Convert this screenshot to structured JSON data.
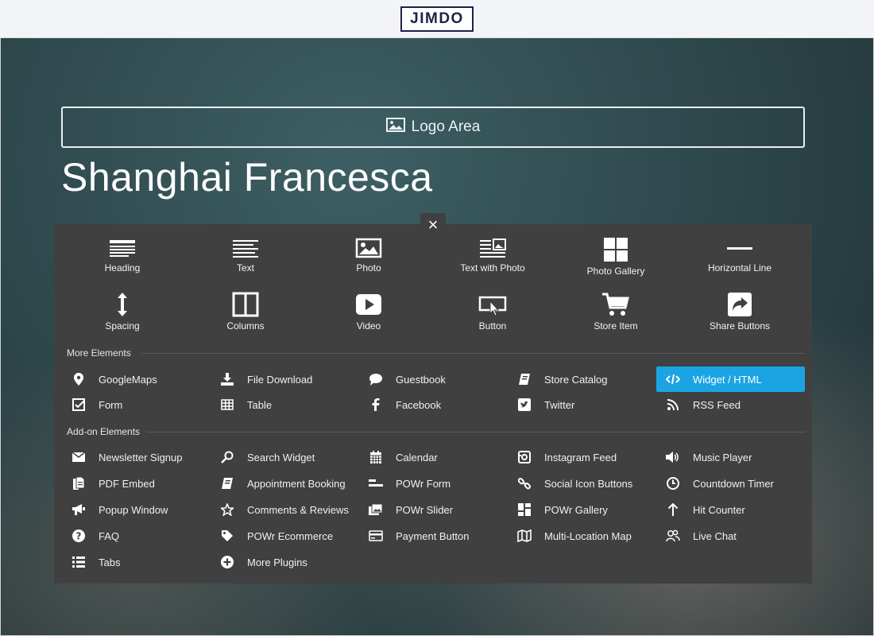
{
  "app": {
    "logo": "JIMDO"
  },
  "hero": {
    "logo_area_label": "Logo Area",
    "site_title": "Shanghai Francesca"
  },
  "panel": {
    "close_label": "×",
    "basic_elements": [
      {
        "label": "Heading",
        "icon": "heading-icon"
      },
      {
        "label": "Text",
        "icon": "text-icon"
      },
      {
        "label": "Photo",
        "icon": "photo-icon"
      },
      {
        "label": "Text with Photo",
        "icon": "text-with-photo-icon"
      },
      {
        "label": "Photo Gallery",
        "icon": "photo-gallery-icon"
      },
      {
        "label": "Horizontal Line",
        "icon": "horizontal-line-icon"
      },
      {
        "label": "Spacing",
        "icon": "spacing-icon"
      },
      {
        "label": "Columns",
        "icon": "columns-icon"
      },
      {
        "label": "Video",
        "icon": "video-icon"
      },
      {
        "label": "Button",
        "icon": "button-icon"
      },
      {
        "label": "Store Item",
        "icon": "cart-icon"
      },
      {
        "label": "Share Buttons",
        "icon": "share-icon"
      }
    ],
    "more_title": "More Elements",
    "more_elements": [
      {
        "label": "GoogleMaps",
        "icon": "map-pin-icon"
      },
      {
        "label": "File Download",
        "icon": "download-icon"
      },
      {
        "label": "Guestbook",
        "icon": "chat-bubble-icon"
      },
      {
        "label": "Store Catalog",
        "icon": "catalog-icon"
      },
      {
        "label": "Widget / HTML",
        "icon": "code-icon",
        "active": true
      },
      {
        "label": "Form",
        "icon": "checkbox-icon"
      },
      {
        "label": "Table",
        "icon": "table-icon"
      },
      {
        "label": "Facebook",
        "icon": "facebook-icon"
      },
      {
        "label": "Twitter",
        "icon": "twitter-icon"
      },
      {
        "label": "RSS Feed",
        "icon": "rss-icon"
      }
    ],
    "addon_title": "Add-on Elements",
    "addon_elements": [
      {
        "label": "Newsletter Signup",
        "icon": "envelope-icon"
      },
      {
        "label": "Search Widget",
        "icon": "search-icon"
      },
      {
        "label": "Calendar",
        "icon": "calendar-icon"
      },
      {
        "label": "Instagram Feed",
        "icon": "instagram-icon"
      },
      {
        "label": "Music Player",
        "icon": "speaker-icon"
      },
      {
        "label": "PDF Embed",
        "icon": "pdf-icon"
      },
      {
        "label": "Appointment Booking",
        "icon": "book-icon"
      },
      {
        "label": "POWr Form",
        "icon": "form-lines-icon"
      },
      {
        "label": "Social Icon Buttons",
        "icon": "link-icon"
      },
      {
        "label": "Countdown Timer",
        "icon": "clock-icon"
      },
      {
        "label": "Popup Window",
        "icon": "megaphone-icon"
      },
      {
        "label": "Comments & Reviews",
        "icon": "star-icon"
      },
      {
        "label": "POWr Slider",
        "icon": "slider-images-icon"
      },
      {
        "label": "POWr Gallery",
        "icon": "gallery-grid-icon"
      },
      {
        "label": "Hit Counter",
        "icon": "arrow-up-icon"
      },
      {
        "label": "FAQ",
        "icon": "question-icon"
      },
      {
        "label": "POWr Ecommerce",
        "icon": "tag-icon"
      },
      {
        "label": "Payment Button",
        "icon": "credit-card-icon"
      },
      {
        "label": "Multi-Location Map",
        "icon": "folded-map-icon"
      },
      {
        "label": "Live Chat",
        "icon": "users-icon"
      },
      {
        "label": "Tabs",
        "icon": "list-icon"
      },
      {
        "label": "More Plugins",
        "icon": "plus-circle-icon"
      }
    ]
  }
}
